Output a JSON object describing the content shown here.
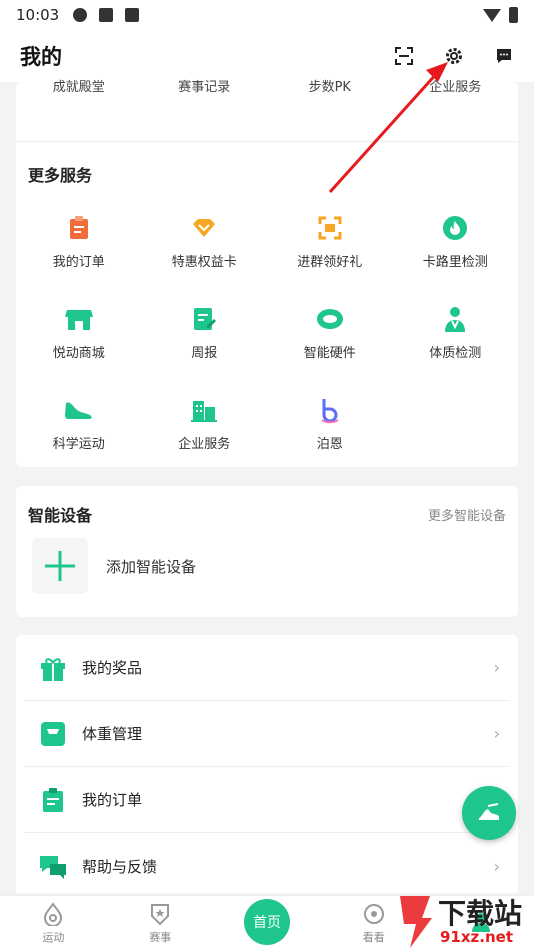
{
  "status_bar": {
    "time": "10:03"
  },
  "header": {
    "title": "我的"
  },
  "top_row": [
    "成就殿堂",
    "赛事记录",
    "步数PK",
    "企业服务"
  ],
  "more_services": {
    "title": "更多服务",
    "items": [
      {
        "label": "我的订单",
        "icon": "order-icon",
        "color": "#f26b3a"
      },
      {
        "label": "特惠权益卡",
        "icon": "diamond-icon",
        "color": "#f5a623"
      },
      {
        "label": "进群领好礼",
        "icon": "scan-group-icon",
        "color": "#f5a623"
      },
      {
        "label": "卡路里检测",
        "icon": "flame-icon",
        "color": "#1ec58f"
      },
      {
        "label": "悦动商城",
        "icon": "shop-icon",
        "color": "#1ec58f"
      },
      {
        "label": "周报",
        "icon": "report-icon",
        "color": "#1ec58f"
      },
      {
        "label": "智能硬件",
        "icon": "band-icon",
        "color": "#1ec58f"
      },
      {
        "label": "体质检测",
        "icon": "doctor-icon",
        "color": "#1ec58f"
      },
      {
        "label": "科学运动",
        "icon": "shoe-icon",
        "color": "#1ec58f"
      },
      {
        "label": "企业服务",
        "icon": "building-icon",
        "color": "#1ec58f"
      },
      {
        "label": "泊恩",
        "icon": "boen-icon",
        "color": "#5b6ef5"
      }
    ]
  },
  "devices": {
    "title": "智能设备",
    "more": "更多智能设备",
    "add_label": "添加智能设备"
  },
  "list": [
    {
      "label": "我的奖品",
      "icon": "gift-icon"
    },
    {
      "label": "体重管理",
      "icon": "scale-icon"
    },
    {
      "label": "我的订单",
      "icon": "order-icon"
    },
    {
      "label": "帮助与反馈",
      "icon": "chat-icon"
    }
  ],
  "tabbar": [
    {
      "label": "运动",
      "icon": "drop-icon"
    },
    {
      "label": "赛事",
      "icon": "shield-star-icon"
    },
    {
      "label": "首页",
      "icon": "home-icon"
    },
    {
      "label": "看看",
      "icon": "eye-icon"
    },
    {
      "label": "",
      "icon": "profile-icon"
    }
  ],
  "watermark": {
    "big": "下载站",
    "small": "91xz.net"
  },
  "accent": "#1ec58f"
}
